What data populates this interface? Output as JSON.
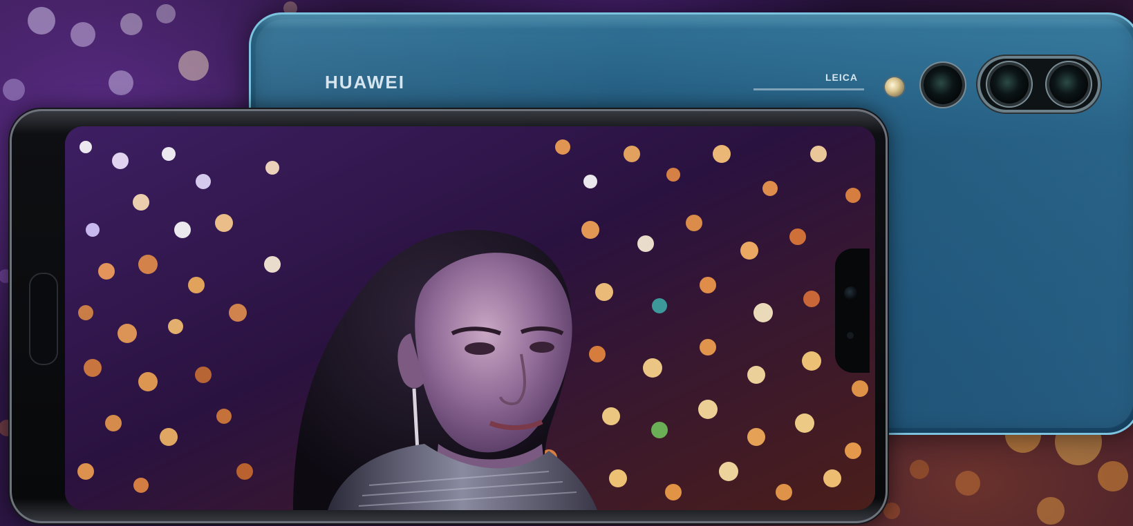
{
  "phone_back": {
    "brand": "HUAWEI",
    "lens_brand": "LEICA",
    "body_color": "#1d4f73",
    "frame_color": "#7cc3df"
  },
  "phone_front": {
    "frame_color": "#6d727b"
  },
  "scene": {
    "subject": "woman-portrait",
    "backdrop": "bokeh-lights"
  }
}
